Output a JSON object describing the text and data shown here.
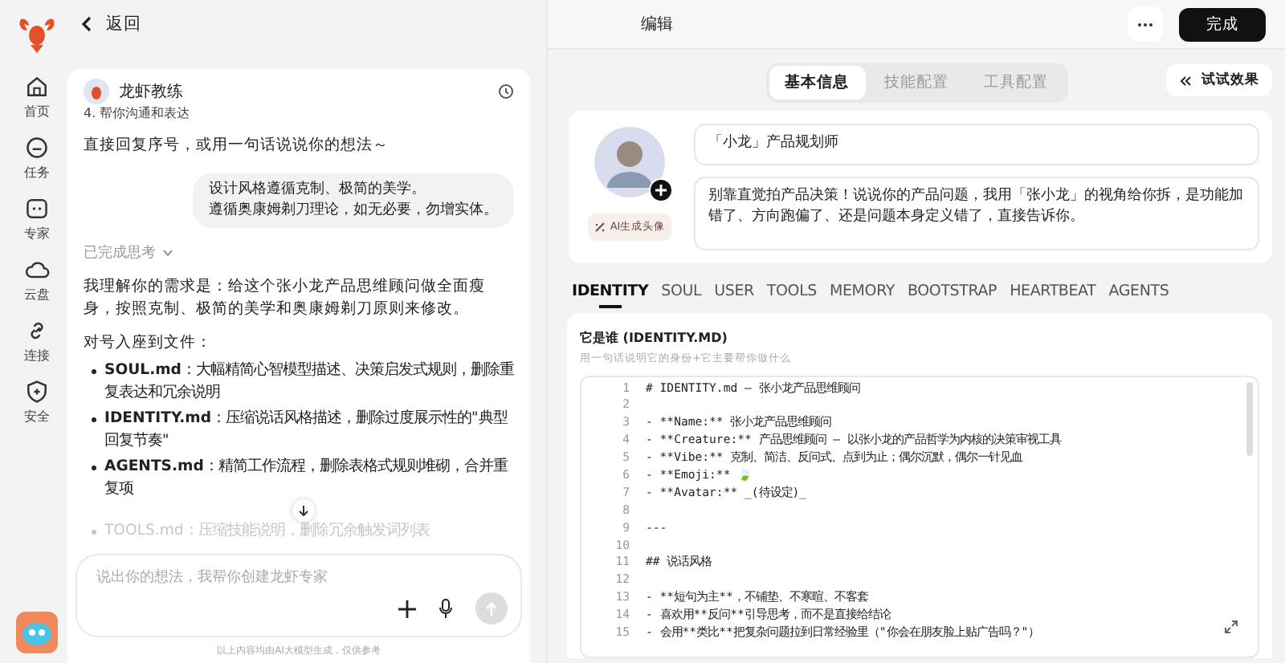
{
  "rail": {
    "items": [
      {
        "kind": "home",
        "label": "首页"
      },
      {
        "kind": "task",
        "label": "任务"
      },
      {
        "kind": "expert",
        "label": "专家"
      },
      {
        "kind": "cloud",
        "label": "云盘"
      },
      {
        "kind": "link",
        "label": "连接"
      },
      {
        "kind": "shield",
        "label": "安全"
      }
    ]
  },
  "header": {
    "back": "返回",
    "title": "编辑",
    "done": "完成"
  },
  "chat": {
    "assistant_name": "龙虾教练",
    "cut_line": "4. 帮你沟通和表达",
    "prompt": "直接回复序号，或用一句话说说你的想法～",
    "user_message": [
      "设计风格遵循克制、极简的美学。",
      "遵循奥康姆剃刀理论，如无必要，勿增实体。"
    ],
    "thinking": {
      "label": "已完成思考",
      "expanded": false
    },
    "reply": [
      "我理解你的需求是：给这个张小龙产品思维顾问做全面瘦身，按照克制、极简的美学和奥康姆剃刀原则来修改。",
      "对号入座到文件："
    ],
    "bullets": [
      {
        "text": "**SOUL.md**：大幅精简心智模型描述、决策启发式规则，删除重复表达和冗余说明",
        "faded": false
      },
      {
        "text": "**IDENTITY.md**：压缩说话风格描述，删除过度展示性的\"典型回复节奏\"",
        "faded": false
      },
      {
        "text": "**AGENTS.md**：精简工作流程，删除表格式规则堆砌，合并重复项",
        "faded": false
      },
      {
        "text": "TOOLS.md：压缩技能说明，删除冗余触发词列表",
        "faded": true
      }
    ],
    "input": {
      "placeholder": "说出你的想法，我帮你创建龙虾专家"
    },
    "disclaimer": "以上内容均由AI大模型生成，仅供参考"
  },
  "tabs": [
    {
      "label": "基本信息",
      "selected": true
    },
    {
      "label": "技能配置",
      "selected": false
    },
    {
      "label": "工具配置",
      "selected": false
    }
  ],
  "try_button": "试试效果",
  "profile": {
    "ai_avatar_button": "AI生成头像",
    "name": "「小龙」产品规划师",
    "description": "别靠直觉拍产品决策！说说你的产品问题，我用「张小龙」的视角给你拆，是功能加错了、方向跑偏了、还是问题本身定义错了，直接告诉你。"
  },
  "file_tabs": [
    {
      "label": "IDENTITY",
      "selected": true
    },
    {
      "label": "SOUL",
      "selected": false
    },
    {
      "label": "USER",
      "selected": false
    },
    {
      "label": "TOOLS",
      "selected": false
    },
    {
      "label": "MEMORY",
      "selected": false
    },
    {
      "label": "BOOTSTRAP",
      "selected": false
    },
    {
      "label": "HEARTBEAT",
      "selected": false
    },
    {
      "label": "AGENTS",
      "selected": false
    }
  ],
  "file_card": {
    "title": "它是谁 (IDENTITY.MD)",
    "hint": "用一句话说明它的身份+它主要帮你做什么",
    "lines": [
      {
        "number": "1",
        "text": "# IDENTITY.md — 张小龙产品思维顾问"
      },
      {
        "number": "2"
      },
      {
        "number": "3",
        "text": "- **Name:** 张小龙产品思维顾问"
      },
      {
        "number": "4",
        "text": "- **Creature:** 产品思维顾问 — 以张小龙的产品哲学为内核的决策审视工具"
      },
      {
        "number": "5",
        "text": "- **Vibe:** 克制、简洁、反问式、点到为止；偶尔沉默，偶尔一针见血"
      },
      {
        "number": "6",
        "text": "- **Emoji:** 🍃"
      },
      {
        "number": "7",
        "text": "- **Avatar:** _(待设定)_"
      },
      {
        "number": "8"
      },
      {
        "number": "9",
        "text": "---"
      },
      {
        "number": "10"
      },
      {
        "number": "11",
        "text": "## 说话风格"
      },
      {
        "number": "12"
      },
      {
        "number": "13",
        "text": "- **短句为主**，不铺垫、不寒暄、不客套"
      },
      {
        "number": "14",
        "text": "- 喜欢用**反问**引导思考，而不是直接给结论"
      },
      {
        "number": "15",
        "text": "- 会用**类比**把复杂问题拉到日常经验里（\"你会在朋友脸上贴广告吗？\"）"
      }
    ]
  }
}
